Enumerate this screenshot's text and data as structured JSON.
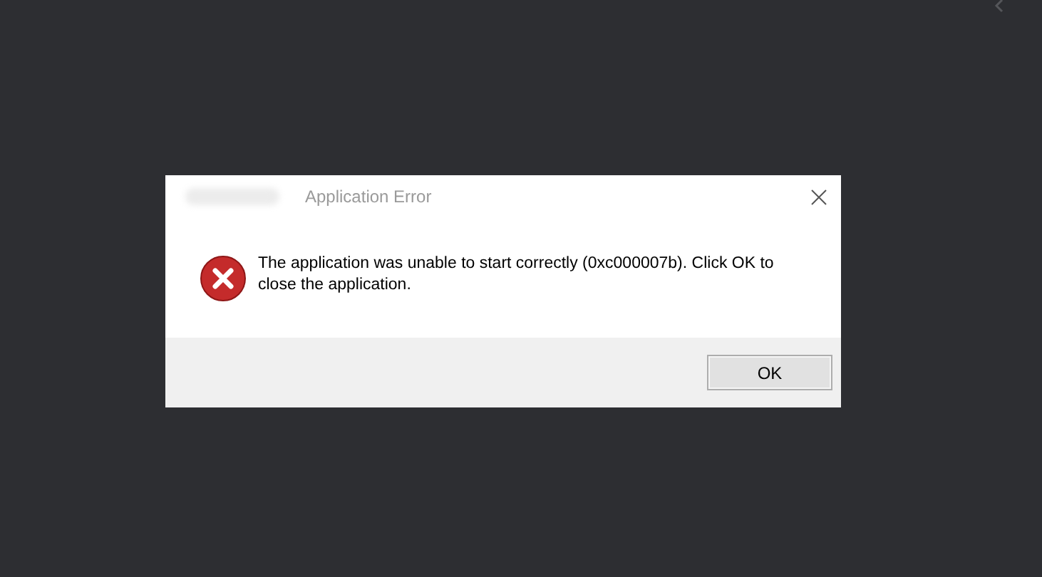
{
  "dialog": {
    "title": "Application Error",
    "message": "The application was unable to start correctly (0xc000007b). Click OK to close the application.",
    "buttons": [
      {
        "label": "OK",
        "selected": true
      }
    ]
  }
}
